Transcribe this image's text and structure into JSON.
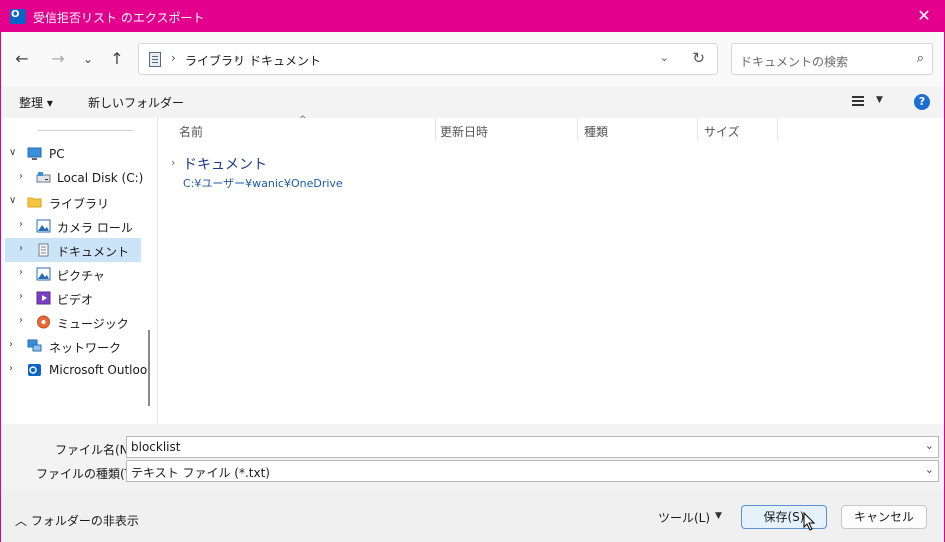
{
  "window": {
    "title": "受信拒否リスト のエクスポート"
  },
  "nav": {
    "back_label": "←",
    "forward_label": "→",
    "recent_label": "⌄",
    "up_label": "↑",
    "breadcrumb": [
      "ライブラリ",
      "ドキュメント"
    ],
    "search_placeholder": "ドキュメントの検索"
  },
  "toolbar": {
    "organize_label": "整理 ▾",
    "new_folder_label": "新しいフォルダー",
    "help_label": "?"
  },
  "tree": {
    "items": [
      {
        "label": "PC",
        "icon": "pc-icon"
      },
      {
        "label": "Local Disk (C:)",
        "icon": "drive-icon"
      },
      {
        "label": "ライブラリ",
        "icon": "folder-icon"
      },
      {
        "label": "カメラ ロール",
        "icon": "image-icon"
      },
      {
        "label": "ドキュメント",
        "icon": "document-icon"
      },
      {
        "label": "ピクチャ",
        "icon": "image-icon"
      },
      {
        "label": "ビデオ",
        "icon": "video-icon"
      },
      {
        "label": "ミュージック",
        "icon": "music-icon"
      },
      {
        "label": "ネットワーク",
        "icon": "network-icon"
      },
      {
        "label": "Microsoft Outloo",
        "icon": "outlook-icon"
      }
    ]
  },
  "columns": {
    "name": "名前",
    "modified": "更新日時",
    "type": "種類",
    "size": "サイズ"
  },
  "content": {
    "group_title": "ドキュメント",
    "group_path": "C:¥ユーザー¥wanic¥OneDrive"
  },
  "fields": {
    "filename_label": "ファイル名(N):",
    "filename_value": "blocklist",
    "filetype_label": "ファイルの種類(T):",
    "filetype_value": "テキスト ファイル (*.txt)"
  },
  "footer": {
    "hide_folders_label": "フォルダーの非表示",
    "tools_label": "ツール(L)",
    "save_label": "保存(S)",
    "cancel_label": "キャンセル"
  },
  "colors": {
    "title_bar": "#e3008c",
    "selection": "#cce4f7",
    "primary_button": "#e5f1fb",
    "link_blue": "#1e5aa8"
  }
}
